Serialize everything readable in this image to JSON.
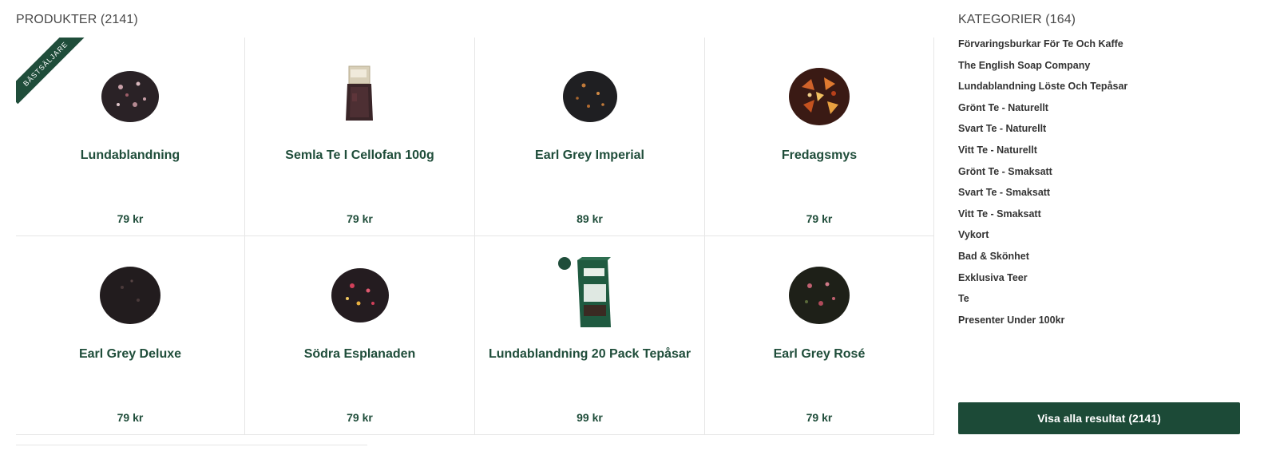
{
  "products": {
    "title": "PRODUKTER (2141)",
    "items": [
      {
        "name": "Lundablandning",
        "price": "79 kr",
        "badge": "BÄSTSÄLJARE",
        "icon": "loose-tea-icon"
      },
      {
        "name": "Semla Te I Cellofan 100g",
        "price": "79 kr",
        "icon": "tea-bag-package-icon"
      },
      {
        "name": "Earl Grey Imperial",
        "price": "89 kr",
        "icon": "loose-tea-icon"
      },
      {
        "name": "Fredagsmys",
        "price": "79 kr",
        "icon": "loose-tea-icon"
      },
      {
        "name": "Earl Grey Deluxe",
        "price": "79 kr",
        "icon": "loose-tea-icon"
      },
      {
        "name": "Södra Esplanaden",
        "price": "79 kr",
        "icon": "loose-tea-icon"
      },
      {
        "name": "Lundablandning 20 Pack Tepåsar",
        "price": "99 kr",
        "icon": "tea-box-icon"
      },
      {
        "name": "Earl Grey Rosé",
        "price": "79 kr",
        "icon": "loose-tea-icon"
      }
    ]
  },
  "categories": {
    "title": "KATEGORIER (164)",
    "items": [
      "Förvaringsburkar För Te Och Kaffe",
      "The English Soap Company",
      "Lundablandning Löste Och Tepåsar",
      "Grönt Te - Naturellt",
      "Svart Te - Naturellt",
      "Vitt Te - Naturellt",
      "Grönt Te - Smaksatt",
      "Svart Te - Smaksatt",
      "Vitt Te - Smaksatt",
      "Vykort",
      "Bad & Skönhet",
      "Exklusiva Teer",
      "Te",
      "Presenter Under 100kr"
    ]
  },
  "show_all_label": "Visa alla resultat (2141)",
  "colors": {
    "brand_green": "#1f4d3a",
    "button_green": "#1c4a37",
    "border": "#e6e6e6"
  }
}
